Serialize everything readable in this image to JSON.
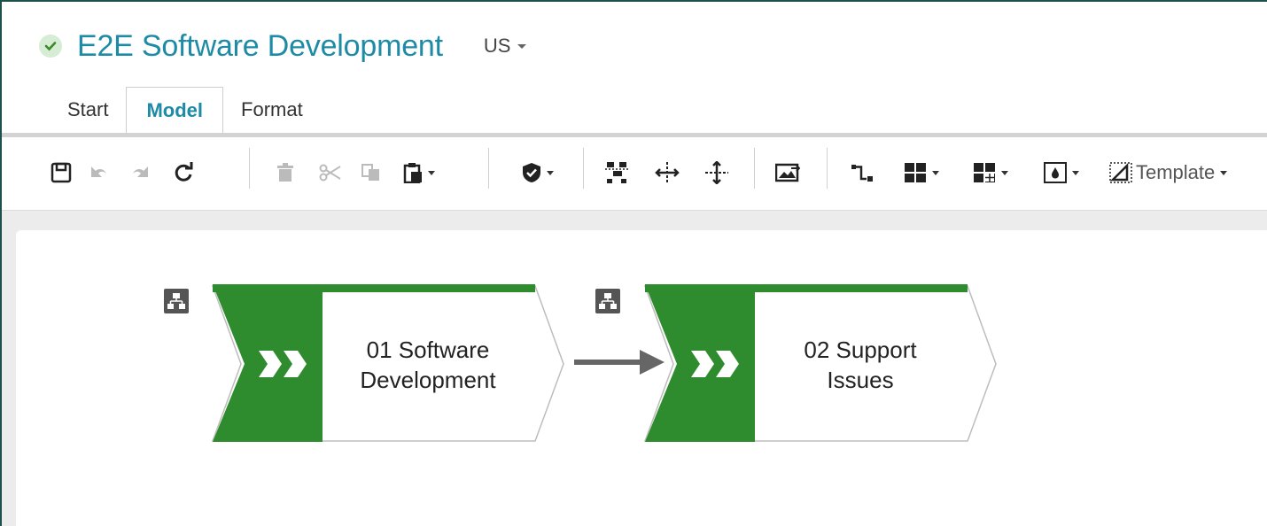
{
  "header": {
    "title": "E2E Software Development",
    "language": "US",
    "status": "released",
    "status_color": "#6aa84f"
  },
  "tabs": [
    {
      "label": "Start",
      "active": false
    },
    {
      "label": "Model",
      "active": true
    },
    {
      "label": "Format",
      "active": false
    }
  ],
  "toolbar": {
    "buttons": [
      "save-icon",
      "undo-icon",
      "redo-icon",
      "refresh-icon",
      "delete-icon",
      "cut-icon",
      "copy-icon",
      "paste-icon",
      "shield-icon",
      "layout-icon",
      "horizontal-spacing-icon",
      "vertical-spacing-icon",
      "image-export-icon",
      "connection-icon",
      "grid-icon",
      "table-icon",
      "fill-icon"
    ],
    "template_label": "Template"
  },
  "diagram": {
    "accent_color": "#2e8b2e",
    "processes": [
      {
        "label_line1": "01 Software",
        "label_line2": "Development"
      },
      {
        "label_line1": "02 Support",
        "label_line2": "Issues"
      }
    ]
  }
}
